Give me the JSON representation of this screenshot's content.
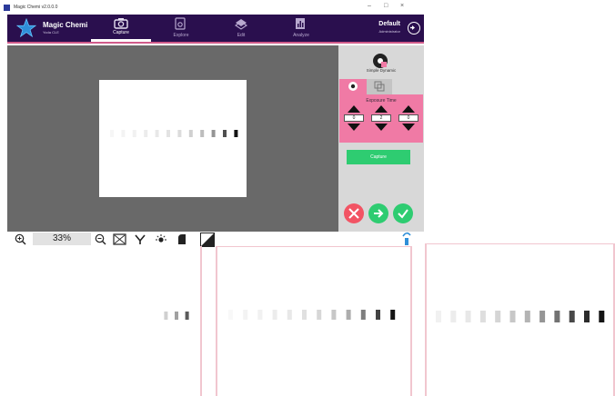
{
  "window": {
    "title": "Magic Chemi v2.0.0.0",
    "controls": {
      "minimize": "–",
      "maximize": "□",
      "close": "×"
    }
  },
  "header": {
    "brand": "Magic Chemi",
    "brand_sub": "Yoda CLE",
    "tabs": [
      {
        "label": "Capture",
        "icon": "camera-icon",
        "active": true
      },
      {
        "label": "Explore",
        "icon": "explore-icon",
        "active": false
      },
      {
        "label": "Edit",
        "icon": "edit-icon",
        "active": false
      },
      {
        "label": "Analyze",
        "icon": "analyze-icon",
        "active": false
      }
    ],
    "profile_name": "Default",
    "profile_role": "Administrator"
  },
  "panel": {
    "mode_label": "Simple Dynamic",
    "exposure_title": "Exposure Time",
    "exposure_values": [
      "0",
      "2",
      "0"
    ],
    "capture_label": "Capture"
  },
  "toolbar": {
    "zoom_value": "33%"
  },
  "colors": {
    "header_bg": "#2a0f4e",
    "accent_pink": "#f07aa5",
    "capture_green": "#2ecc71",
    "cancel_red": "#f25464",
    "next_green": "#2ecc71"
  },
  "preview_bands": [
    0.04,
    0.05,
    0.06,
    0.08,
    0.1,
    0.12,
    0.15,
    0.2,
    0.28,
    0.45,
    0.75,
    1.0
  ],
  "thumbnails": [
    {
      "bands": [
        0.0,
        0.0,
        0.0,
        0.0,
        0.0,
        0.0,
        0.0,
        0.0,
        0.0,
        0.2,
        0.4,
        0.7
      ]
    },
    {
      "bands": [
        0.03,
        0.05,
        0.06,
        0.08,
        0.1,
        0.13,
        0.17,
        0.24,
        0.35,
        0.55,
        0.8,
        1.0
      ]
    },
    {
      "bands": [
        0.06,
        0.08,
        0.1,
        0.14,
        0.18,
        0.24,
        0.32,
        0.45,
        0.6,
        0.78,
        0.9,
        1.0
      ]
    }
  ]
}
